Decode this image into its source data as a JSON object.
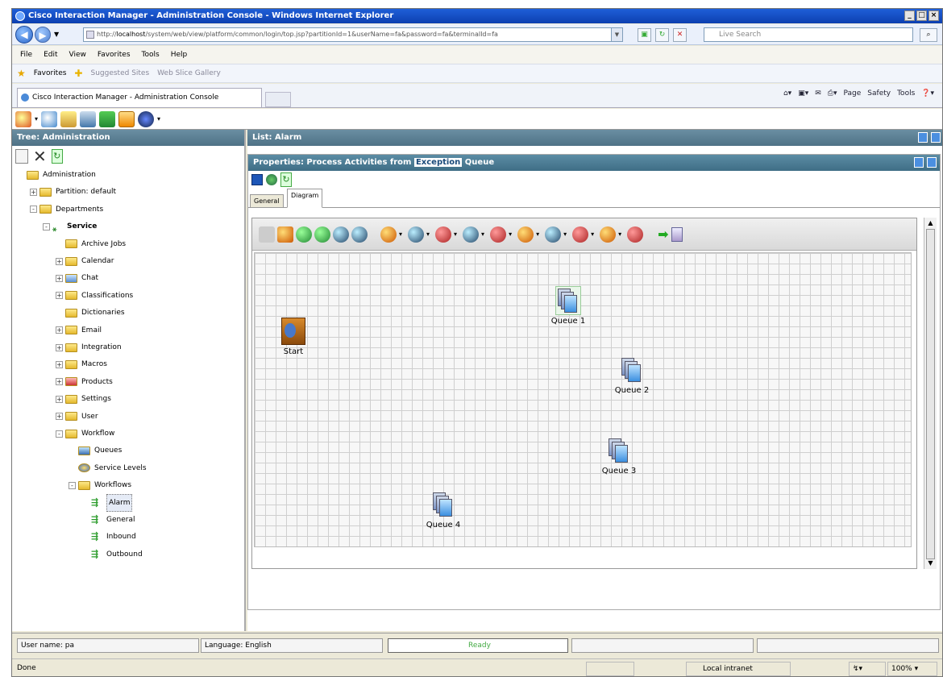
{
  "browser": {
    "title": "Cisco Interaction Manager - Administration Console - Windows Internet Explorer",
    "url_host": "localhost",
    "url_prefix": "http://",
    "url_rest": "/system/web/view/platform/common/login/top.jsp?partitionId=1&userName=fa&password=fa&terminalId=fa",
    "search_placeholder": "Live Search",
    "menu": [
      "File",
      "Edit",
      "View",
      "Favorites",
      "Tools",
      "Help"
    ],
    "favorites": "Favorites",
    "suggested_sites": "Suggested Sites",
    "web_slice": "Web Slice Gallery",
    "tab_title": "Cisco Interaction Manager - Administration Console",
    "cmd": [
      "Page",
      "Safety",
      "Tools"
    ]
  },
  "left": {
    "header": "Tree: Administration",
    "tree": [
      {
        "label": "Administration",
        "indent": 0,
        "icon": "folder",
        "expander": ""
      },
      {
        "label": "Partition: default",
        "indent": 1,
        "icon": "folder",
        "expander": "+"
      },
      {
        "label": "Departments",
        "indent": 1,
        "icon": "folder",
        "expander": "-"
      },
      {
        "label": "Service",
        "indent": 2,
        "icon": "service",
        "expander": "-",
        "bold": true
      },
      {
        "label": "Archive Jobs",
        "indent": 3,
        "icon": "folder",
        "expander": ""
      },
      {
        "label": "Calendar",
        "indent": 3,
        "icon": "folder",
        "expander": "+"
      },
      {
        "label": "Chat",
        "indent": 3,
        "icon": "chat",
        "expander": "+"
      },
      {
        "label": "Classifications",
        "indent": 3,
        "icon": "folder",
        "expander": "+"
      },
      {
        "label": "Dictionaries",
        "indent": 3,
        "icon": "folder",
        "expander": ""
      },
      {
        "label": "Email",
        "indent": 3,
        "icon": "folder",
        "expander": "+"
      },
      {
        "label": "Integration",
        "indent": 3,
        "icon": "folder",
        "expander": "+"
      },
      {
        "label": "Macros",
        "indent": 3,
        "icon": "folder",
        "expander": "+"
      },
      {
        "label": "Products",
        "indent": 3,
        "icon": "products",
        "expander": "+"
      },
      {
        "label": "Settings",
        "indent": 3,
        "icon": "folder",
        "expander": "+"
      },
      {
        "label": "User",
        "indent": 3,
        "icon": "folder",
        "expander": "+"
      },
      {
        "label": "Workflow",
        "indent": 3,
        "icon": "folder",
        "expander": "-"
      },
      {
        "label": "Queues",
        "indent": 4,
        "icon": "queue",
        "expander": ""
      },
      {
        "label": "Service Levels",
        "indent": 4,
        "icon": "servicelevel",
        "expander": ""
      },
      {
        "label": "Workflows",
        "indent": 4,
        "icon": "folder",
        "expander": "-"
      },
      {
        "label": "Alarm",
        "indent": 5,
        "icon": "workflow",
        "expander": "",
        "selected": true
      },
      {
        "label": "General",
        "indent": 5,
        "icon": "workflow",
        "expander": ""
      },
      {
        "label": "Inbound",
        "indent": 5,
        "icon": "workflow",
        "expander": ""
      },
      {
        "label": "Outbound",
        "indent": 5,
        "icon": "workflow",
        "expander": ""
      }
    ]
  },
  "right": {
    "list_header": "List: Alarm",
    "props_prefix": "Properties: Process Activities from ",
    "props_highlight": "Exception",
    "props_suffix": " Queue",
    "tabs": [
      "General",
      "Diagram"
    ],
    "nodes": [
      {
        "label": "Start",
        "type": "start"
      },
      {
        "label": "Queue 1",
        "type": "queue",
        "selected": true
      },
      {
        "label": "Queue 2",
        "type": "queue"
      },
      {
        "label": "Queue 3",
        "type": "queue"
      },
      {
        "label": "Queue 4",
        "type": "queue"
      }
    ]
  },
  "status": {
    "user": "User name: pa",
    "language": "Language: English",
    "ready": "Ready",
    "done": "Done",
    "zone": "Local intranet",
    "zoom": "100%"
  }
}
